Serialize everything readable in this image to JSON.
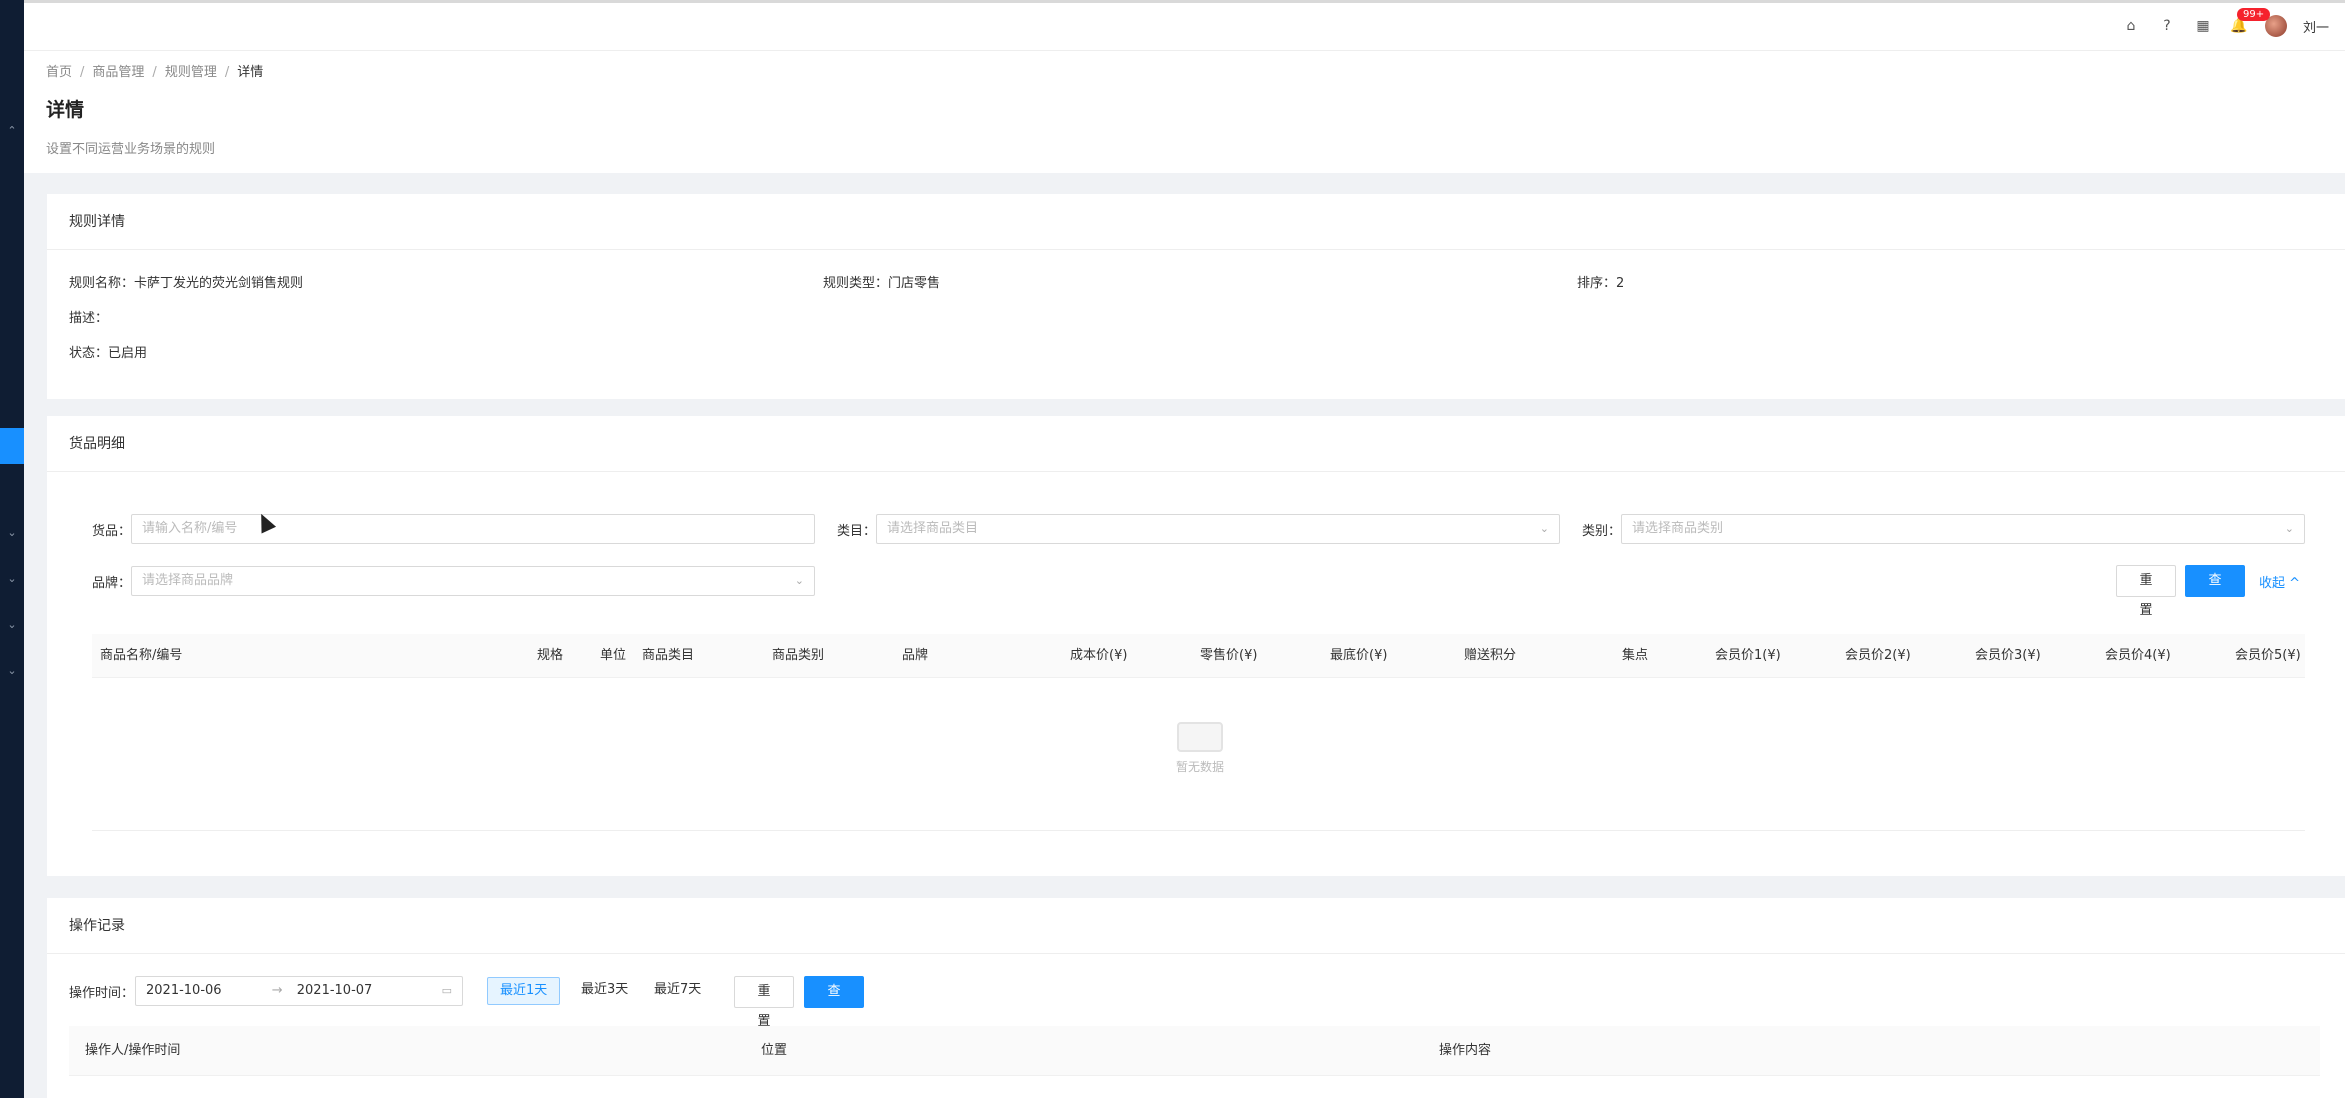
{
  "topbar": {
    "icons": [
      "home-icon",
      "help-icon",
      "apps-icon",
      "bell-icon"
    ],
    "notification_badge": "99+",
    "user_name": "刘一"
  },
  "breadcrumb": [
    "首页",
    "商品管理",
    "规则管理",
    "详情"
  ],
  "page": {
    "title": "详情",
    "description": "设置不同运营业务场景的规则"
  },
  "rule_detail": {
    "heading": "规则详情",
    "name": "规则名称：卡萨丁发光的荧光剑销售规则",
    "type": "规则类型：门店零售",
    "sort": "排序：2",
    "description": "描述：",
    "status": "状态：已启用"
  },
  "goods": {
    "heading": "货品明细",
    "filters": {
      "goods_label": "货品：",
      "goods_placeholder": "请输入名称/编号",
      "category_label": "类目：",
      "category_placeholder": "请选择商品类目",
      "class_label": "类别：",
      "class_placeholder": "请选择商品类别",
      "brand_label": "品牌：",
      "brand_placeholder": "请选择商品品牌"
    },
    "reset_label": "重 置",
    "query_label": "查 询",
    "collapse_label": "收起 ^",
    "columns": [
      "商品名称/编号",
      "规格",
      "单位",
      "商品类目",
      "商品类别",
      "品牌",
      "成本价(¥)",
      "零售价(¥)",
      "最底价(¥)",
      "赠送积分",
      "集点",
      "会员价1(¥)",
      "会员价2(¥)",
      "会员价3(¥)",
      "会员价4(¥)",
      "会员价5(¥)"
    ],
    "empty_text": "暂无数据"
  },
  "log": {
    "heading": "操作记录",
    "time_label": "操作时间：",
    "start_date": "2021-10-06",
    "end_date": "2021-10-07",
    "range_arrow": "→",
    "quick_ranges": [
      "最近1天",
      "最近3天",
      "最近7天"
    ],
    "selected_range": "最近1天",
    "reset_label": "重 置",
    "query_label": "查 询",
    "columns": [
      "操作人/操作时间",
      "位置",
      "操作内容"
    ]
  },
  "colors": {
    "accent": "#1890ff",
    "sidebar": "#0f1d33",
    "badge": "#f5222d"
  }
}
